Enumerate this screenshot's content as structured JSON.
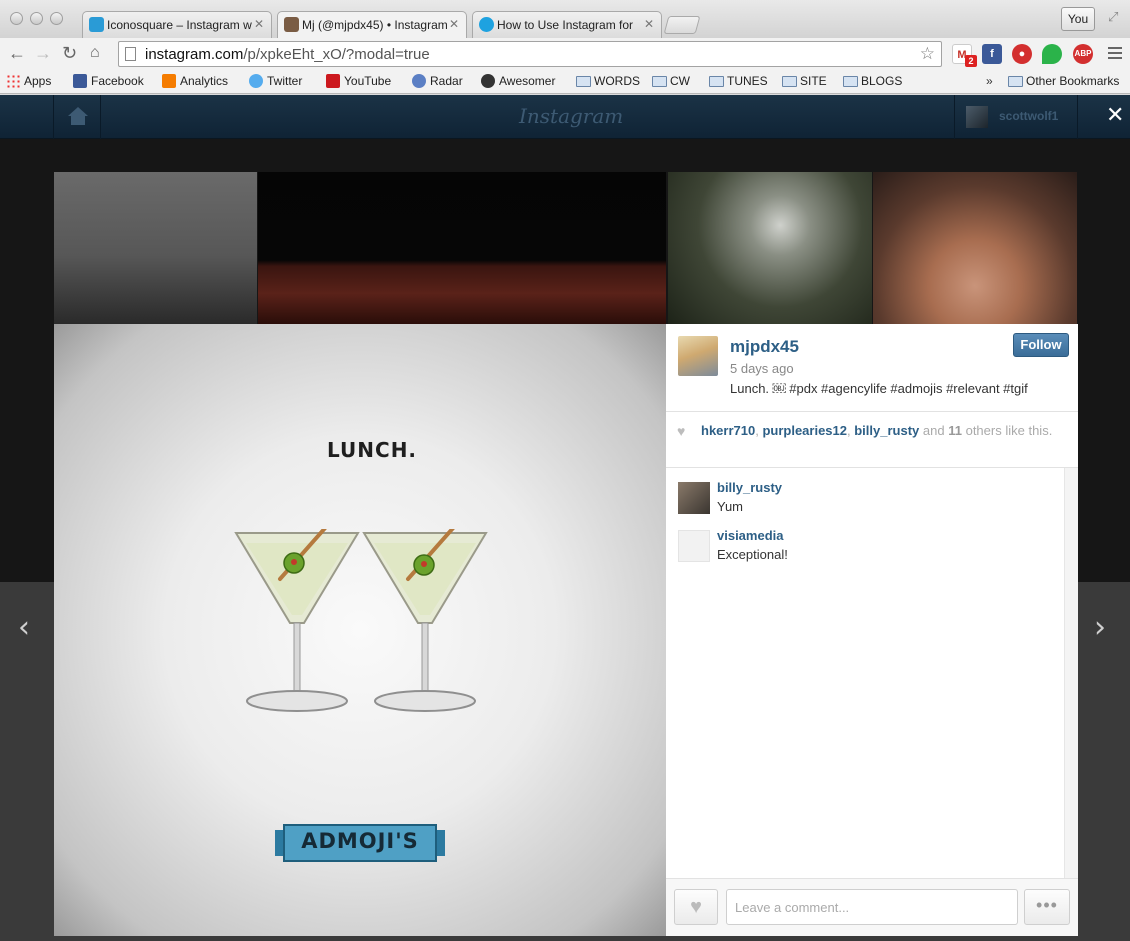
{
  "browser": {
    "tabs": [
      {
        "title": "Iconosquare – Instagram w",
        "favicon_color": "#2a9bd6"
      },
      {
        "title": "Mj (@mjpdx45) • Instagram",
        "favicon_color": "#7a5c44"
      },
      {
        "title": "How to Use Instagram for ",
        "favicon_color": "#1ea2e0"
      }
    ],
    "profile_button": "You",
    "url_host": "instagram.com",
    "url_path": "/p/xpkeEht_xO/?modal=true",
    "gmail_badge": "2",
    "abp_label": "ABP"
  },
  "bookmarks": {
    "items": [
      {
        "label": "Apps",
        "icon": "apps-grid-icon"
      },
      {
        "label": "Facebook",
        "icon": "facebook-icon"
      },
      {
        "label": "Analytics",
        "icon": "analytics-icon"
      },
      {
        "label": "Twitter",
        "icon": "twitter-icon"
      },
      {
        "label": "YouTube",
        "icon": "youtube-icon"
      },
      {
        "label": "Radar",
        "icon": "radar-icon"
      },
      {
        "label": "Awesomer",
        "icon": "awesomer-icon"
      },
      {
        "label": "WORDS",
        "icon": "folder-icon"
      },
      {
        "label": "CW",
        "icon": "folder-icon"
      },
      {
        "label": "TUNES",
        "icon": "folder-icon"
      },
      {
        "label": "SITE",
        "icon": "folder-icon"
      },
      {
        "label": "BLOGS",
        "icon": "folder-icon"
      }
    ],
    "overflow": "»",
    "other": "Other Bookmarks"
  },
  "instagram": {
    "logo": "Instagram",
    "current_user": "scottwolf1",
    "photo": {
      "text": "LUNCH.",
      "banner": "ADMOJI'S"
    },
    "post": {
      "owner": "mjpdx45",
      "time": "5 days ago",
      "caption": "Lunch. ￼ #pdx #agencylife #admojis #relevant #tgif",
      "follow_label": "Follow",
      "likes": {
        "users": [
          "hkerr710",
          "purplearies12",
          "billy_rusty"
        ],
        "and": "and",
        "count": "11",
        "suffix_1": "others like",
        "suffix_2": "this."
      },
      "comments": [
        {
          "user": "billy_rusty",
          "text": "Yum"
        },
        {
          "user": "visiamedia",
          "text": "Exceptional!"
        }
      ],
      "comment_placeholder": "Leave a comment...",
      "more_label": "•••"
    }
  }
}
